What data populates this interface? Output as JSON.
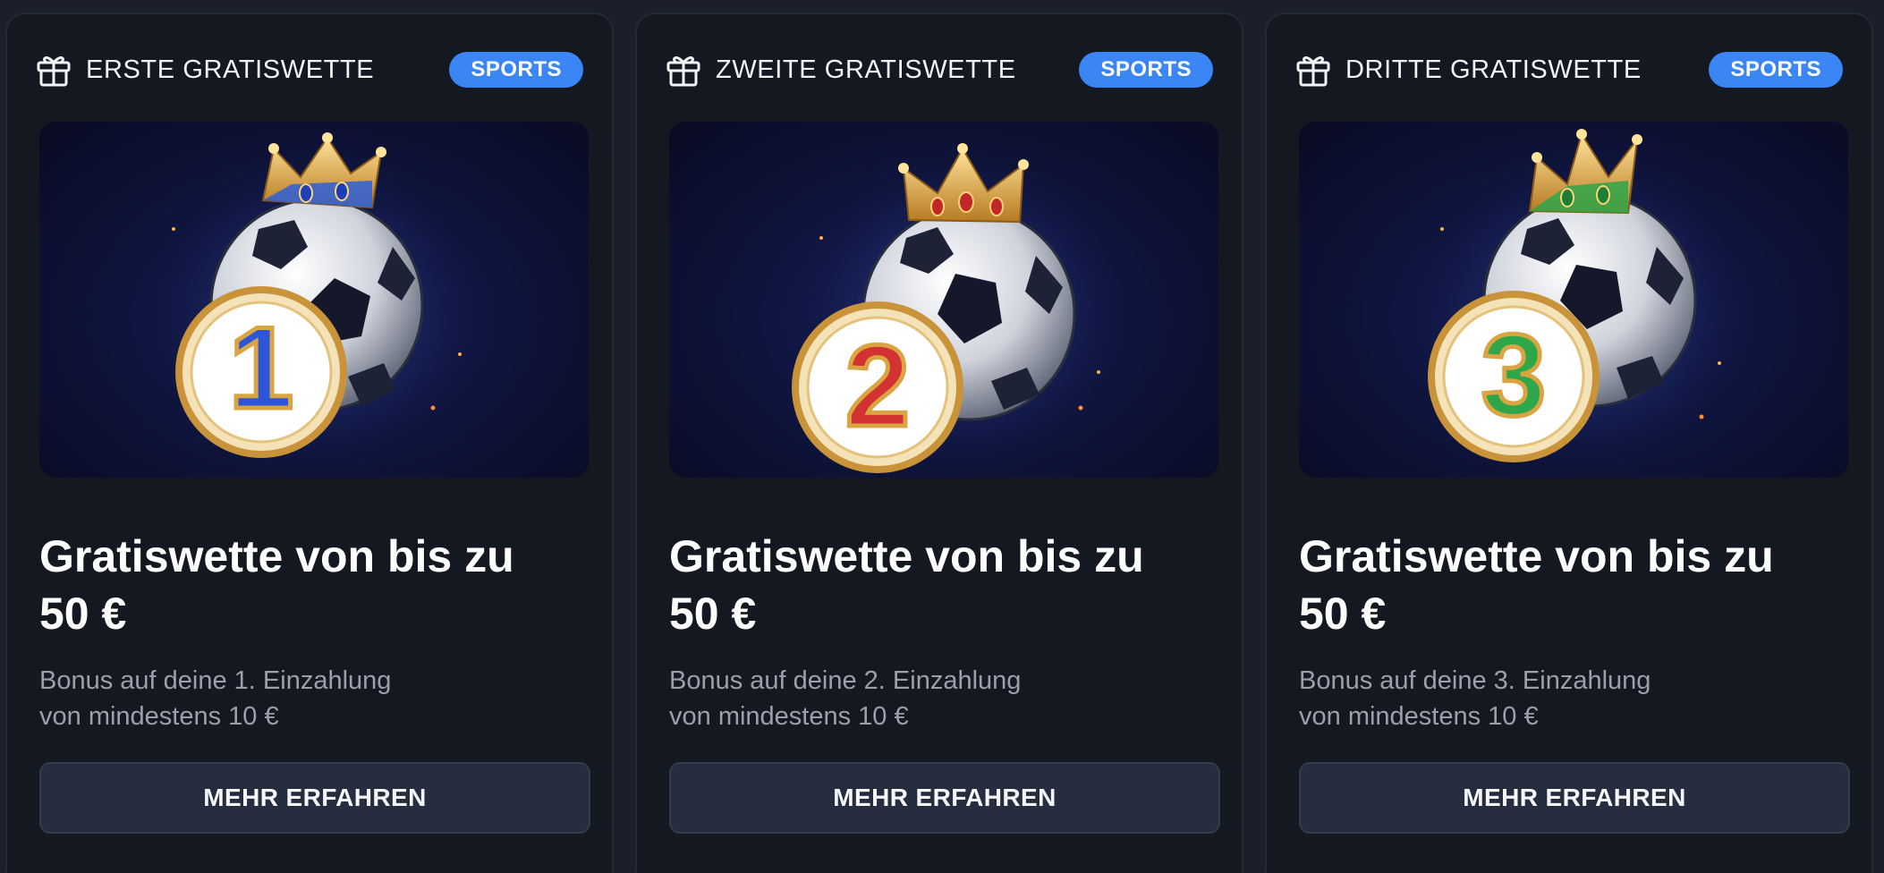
{
  "cards": [
    {
      "title": "ERSTE GRATISWETTE",
      "badge": "SPORTS",
      "icon": "gift-icon",
      "image_number": "1",
      "image_accent": "#2c55d8",
      "headline": "Gratiswette von bis zu",
      "amount": "50 €",
      "desc_line1": "Bonus auf deine 1. Einzahlung",
      "desc_line2": "von mindestens 10 €",
      "button_label": "MEHR ERFAHREN"
    },
    {
      "title": "ZWEITE GRATISWETTE",
      "badge": "SPORTS",
      "icon": "gift-icon",
      "image_number": "2",
      "image_accent": "#d33232",
      "headline": "Gratiswette von bis zu",
      "amount": "50 €",
      "desc_line1": "Bonus auf deine 2. Einzahlung",
      "desc_line2": "von mindestens 10 €",
      "button_label": "MEHR ERFAHREN"
    },
    {
      "title": "DRITTE GRATISWETTE",
      "badge": "SPORTS",
      "icon": "gift-icon",
      "image_number": "3",
      "image_accent": "#2ea64a",
      "headline": "Gratiswette von bis zu",
      "amount": "50 €",
      "desc_line1": "Bonus auf deine 3. Einzahlung",
      "desc_line2": "von mindestens 10 €",
      "button_label": "MEHR ERFAHREN"
    }
  ],
  "colors": {
    "page_background": "#1a1f2b",
    "card_background": "#131821",
    "badge": "#3a86f5",
    "button": "#252d3e",
    "muted_text": "#9aa1ad",
    "gold": "#d9a441"
  }
}
